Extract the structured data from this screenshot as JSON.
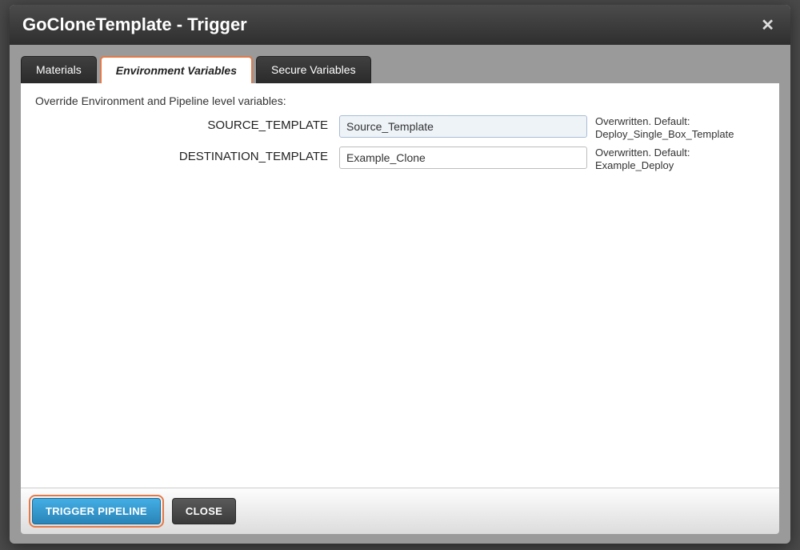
{
  "header": {
    "title": "GoCloneTemplate - Trigger",
    "close": "✕"
  },
  "tabs": [
    {
      "label": "Materials",
      "active": false
    },
    {
      "label": "Environment Variables",
      "active": true
    },
    {
      "label": "Secure Variables",
      "active": false
    }
  ],
  "content": {
    "description": "Override Environment and Pipeline level variables:",
    "variables": [
      {
        "name": "SOURCE_TEMPLATE",
        "value": "Source_Template",
        "hint": "Overwritten. Default: Deploy_Single_Box_Template",
        "highlighted": true
      },
      {
        "name": "DESTINATION_TEMPLATE",
        "value": "Example_Clone",
        "hint": "Overwritten. Default: Example_Deploy",
        "highlighted": false
      }
    ]
  },
  "footer": {
    "trigger": "TRIGGER PIPELINE",
    "close": "CLOSE"
  }
}
